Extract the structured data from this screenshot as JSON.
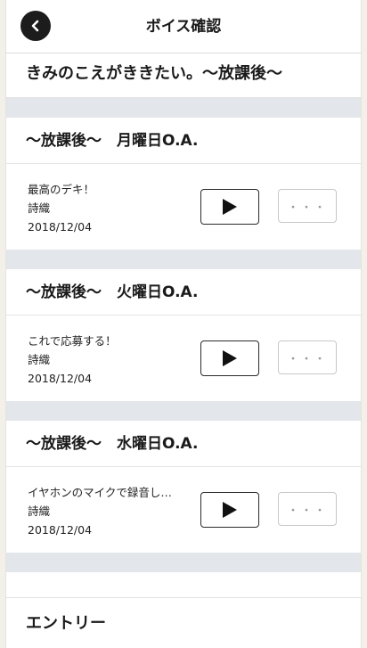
{
  "header": {
    "title": "ボイス確認"
  },
  "album": {
    "title": "きみのこえがききたい。〜放課後〜"
  },
  "sections": [
    {
      "title": "〜放課後〜　月曜日O.A.",
      "voice": {
        "text": "最高のデキ！",
        "speaker": "詩織",
        "date": "2018/12/04"
      }
    },
    {
      "title": "〜放課後〜　火曜日O.A.",
      "voice": {
        "text": "これで応募する！",
        "speaker": "詩織",
        "date": "2018/12/04"
      }
    },
    {
      "title": "〜放課後〜　水曜日O.A.",
      "voice": {
        "text": "イヤホンのマイクで録音し…",
        "speaker": "詩織",
        "date": "2018/12/04"
      }
    }
  ],
  "more_label": "・・・",
  "entry": {
    "label": "エントリー"
  },
  "icons": {
    "back": "chevron-left-icon",
    "play": "play-icon",
    "more": "more-icon"
  }
}
